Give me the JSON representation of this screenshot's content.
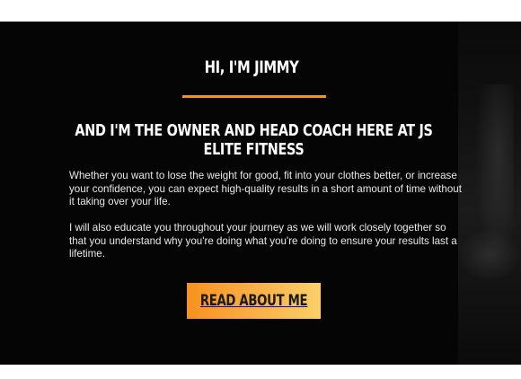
{
  "intro": {
    "heading": "HI, I'M JIMMY",
    "subheading": "AND I'M THE OWNER AND HEAD COACH HERE AT JS ELITE FITNESS",
    "paragraphs": [
      "Whether you want to lose the weight for good, fit into your clothes better, or increase your confidence, you can expect high-quality results in a short amount of time without it taking over your life.",
      "I will also educate you throughout your journey as we will work closely together so that you understand why you're doing what you're doing to ensure your results last a lifetime."
    ],
    "cta_label": "READ ABOUT ME"
  },
  "colors": {
    "accent": "#f7921e",
    "background": "#050505",
    "text": "#ffffff"
  }
}
